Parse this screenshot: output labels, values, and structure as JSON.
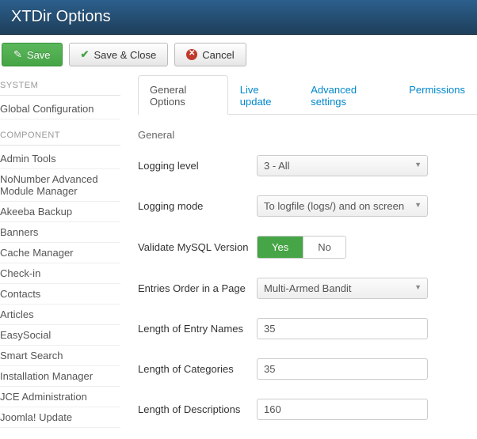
{
  "header": {
    "title": "XTDir Options"
  },
  "toolbar": {
    "save": "Save",
    "save_close": "Save & Close",
    "cancel": "Cancel"
  },
  "sidebar": {
    "groups": [
      {
        "title": "SYSTEM",
        "items": [
          "Global Configuration"
        ]
      },
      {
        "title": "COMPONENT",
        "items": [
          "Admin Tools",
          "NoNumber Advanced Module Manager",
          "Akeeba Backup",
          "Banners",
          "Cache Manager",
          "Check-in",
          "Contacts",
          "Articles",
          "EasySocial",
          "Smart Search",
          "Installation Manager",
          "JCE Administration",
          "Joomla! Update"
        ]
      }
    ]
  },
  "tabs": [
    "General Options",
    "Live update",
    "Advanced settings",
    "Permissions"
  ],
  "active_tab": 0,
  "section": "General",
  "fields": {
    "logging_level": {
      "label": "Logging level",
      "value": "3 - All"
    },
    "logging_mode": {
      "label": "Logging mode",
      "value": "To logfile (logs/) and on screen"
    },
    "validate_mysql": {
      "label": "Validate MySQL Version",
      "yes": "Yes",
      "no": "No",
      "value": "Yes"
    },
    "entries_order": {
      "label": "Entries Order in a Page",
      "value": "Multi-Armed Bandit"
    },
    "len_entry": {
      "label": "Length of Entry Names",
      "value": "35"
    },
    "len_cat": {
      "label": "Length of Categories",
      "value": "35"
    },
    "len_desc": {
      "label": "Length of Descriptions",
      "value": "160"
    }
  }
}
